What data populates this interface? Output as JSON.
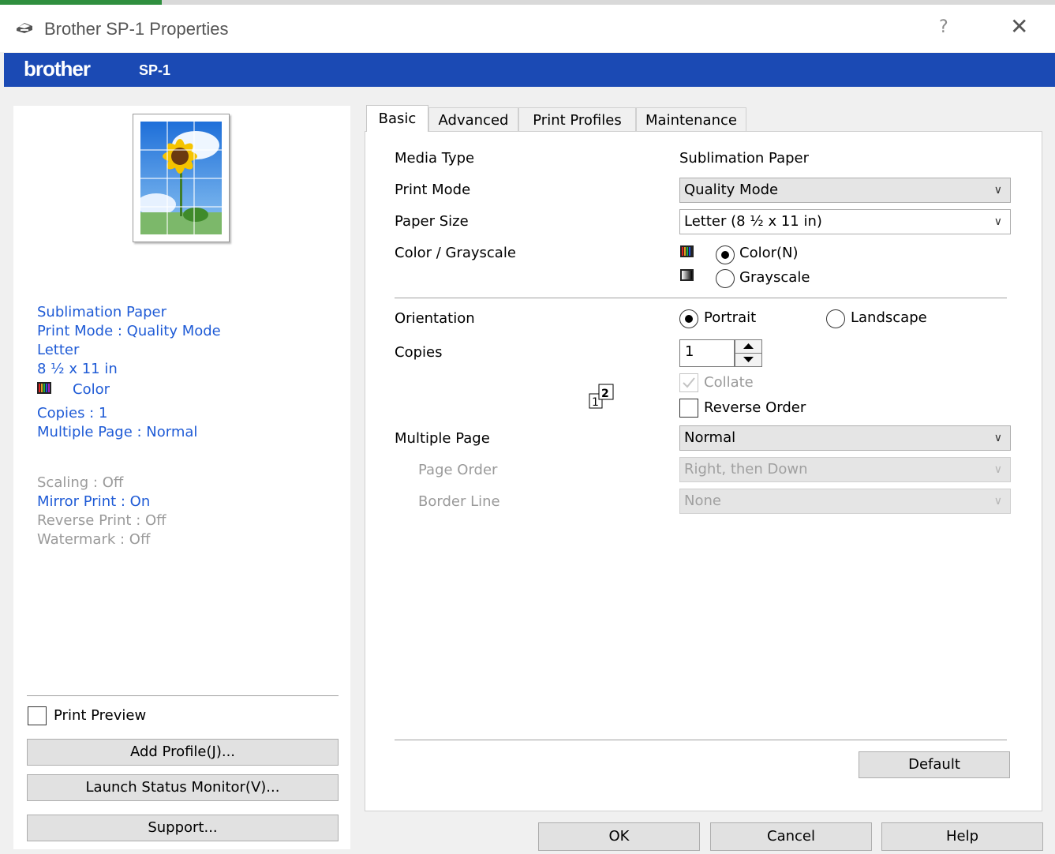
{
  "window": {
    "title": "Brother SP-1 Properties",
    "help_glyph": "?",
    "close_glyph": "✕"
  },
  "brand": {
    "logo": "brother",
    "model": "SP-1"
  },
  "summary": {
    "media_type": "Sublimation Paper",
    "print_mode": "Print Mode : Quality Mode",
    "paper": "Letter",
    "paper_dims": "8 ½ x 11  in",
    "color": "Color",
    "copies": "Copies : 1",
    "multiple_page": "Multiple Page : Normal",
    "scaling": "Scaling : Off",
    "mirror_print": "Mirror Print : On",
    "reverse_print": "Reverse Print : Off",
    "watermark": "Watermark : Off"
  },
  "left_actions": {
    "print_preview_label": "Print Preview",
    "print_preview_checked": false,
    "add_profile": "Add Profile(J)...",
    "launch_status_monitor": "Launch Status Monitor(V)...",
    "support": "Support..."
  },
  "tabs": [
    {
      "label": "Basic",
      "active": true
    },
    {
      "label": "Advanced",
      "active": false
    },
    {
      "label": "Print Profiles",
      "active": false
    },
    {
      "label": "Maintenance",
      "active": false
    }
  ],
  "basic": {
    "media_type_label": "Media Type",
    "media_type_value": "Sublimation Paper",
    "print_mode_label": "Print Mode",
    "print_mode_value": "Quality Mode",
    "paper_size_label": "Paper Size",
    "paper_size_value": "Letter (8 ½ x 11  in)",
    "color_label": "Color / Grayscale",
    "color_option": "Color(N)",
    "grayscale_option": "Grayscale",
    "color_selected": "Color(N)",
    "orientation_label": "Orientation",
    "portrait": "Portrait",
    "landscape": "Landscape",
    "orientation_selected": "Portrait",
    "copies_label": "Copies",
    "copies_value": "1",
    "collate_label": "Collate",
    "collate_checked": true,
    "collate_enabled": false,
    "reverse_order_label": "Reverse Order",
    "reverse_order_checked": false,
    "multiple_page_label": "Multiple Page",
    "multiple_page_value": "Normal",
    "page_order_label": "Page Order",
    "page_order_value": "Right, then Down",
    "border_line_label": "Border Line",
    "border_line_value": "None",
    "default_button": "Default"
  },
  "dialog_buttons": {
    "ok": "OK",
    "cancel": "Cancel",
    "help": "Help"
  },
  "colors": {
    "brand_bar": "#1b4ab4",
    "summary_text": "#1f5bd6",
    "disabled_text": "#9a9a9a"
  }
}
